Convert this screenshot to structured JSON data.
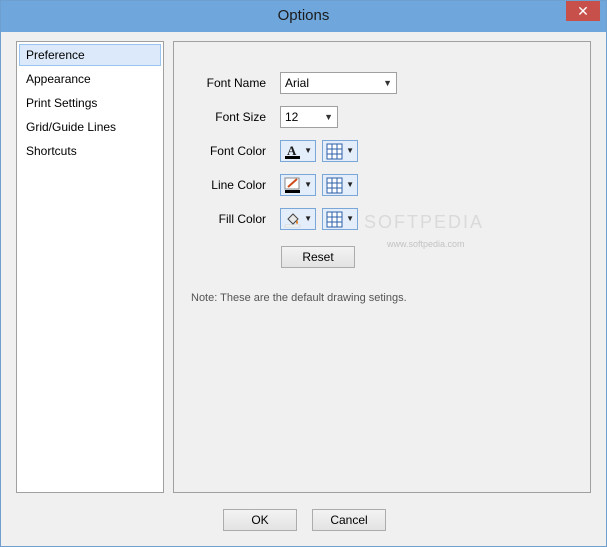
{
  "window": {
    "title": "Options",
    "close_glyph": "✕"
  },
  "sidebar": {
    "items": [
      {
        "label": "Preference",
        "selected": true
      },
      {
        "label": "Appearance"
      },
      {
        "label": "Print Settings"
      },
      {
        "label": "Grid/Guide Lines"
      },
      {
        "label": "Shortcuts"
      }
    ]
  },
  "preference": {
    "font_name": {
      "label": "Font Name",
      "value": "Arial"
    },
    "font_size": {
      "label": "Font Size",
      "value": "12"
    },
    "font_color": {
      "label": "Font Color",
      "icon": "font-color-icon"
    },
    "line_color": {
      "label": "Line Color",
      "icon": "line-color-icon"
    },
    "fill_color": {
      "label": "Fill Color",
      "icon": "fill-color-icon"
    },
    "reset_label": "Reset",
    "note": "Note: These are the default drawing setings."
  },
  "watermark": {
    "text": "SOFTPEDIA",
    "sub": "www.softpedia.com"
  },
  "footer": {
    "ok_label": "OK",
    "cancel_label": "Cancel"
  },
  "colors": {
    "accent": "#6fa7dc",
    "selection": "#dbe9fa",
    "close": "#c7504b"
  }
}
